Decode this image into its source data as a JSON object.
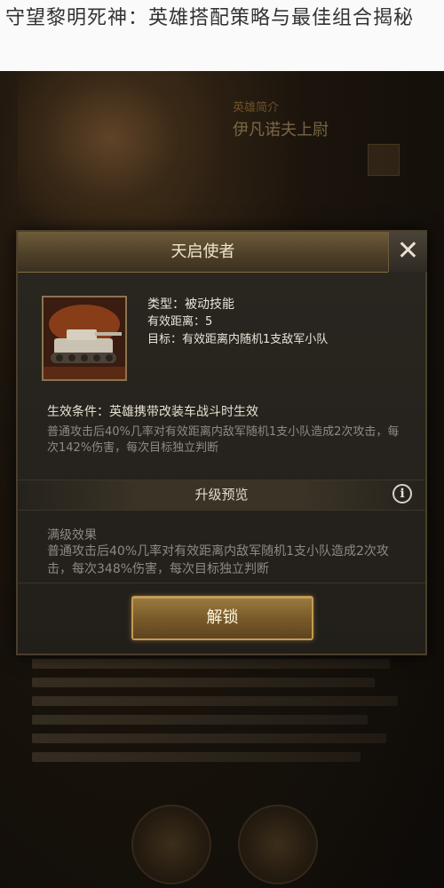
{
  "article": {
    "title": "守望黎明死神：英雄搭配策略与最佳组合揭秘"
  },
  "background": {
    "hero_label": "英雄简介",
    "hero_name": "伊凡诺夫上尉"
  },
  "dialog": {
    "title": "天启使者",
    "close_label": "✕",
    "skill": {
      "icon_name": "tank-icon",
      "type": "类型：被动技能",
      "range": "有效距离：5",
      "target": "目标：有效距离内随机1支敌军小队"
    },
    "condition": {
      "title": "生效条件：英雄携带改装车战斗时生效",
      "description": "普通攻击后40%几率对有效距离内敌军随机1支小队造成2次攻击，每次142%伤害，每次目标独立判断"
    },
    "upgrade": {
      "label": "升级预览",
      "info_icon": "i"
    },
    "max_level": {
      "title": "满级效果",
      "description": "普通攻击后40%几率对有效距离内敌军随机1支小队造成2次攻击，每次348%伤害，每次目标独立判断"
    },
    "unlock_label": "解锁"
  },
  "colors": {
    "accent": "#c49a52",
    "header": "#6e5c3a",
    "panel": "#26221c"
  }
}
